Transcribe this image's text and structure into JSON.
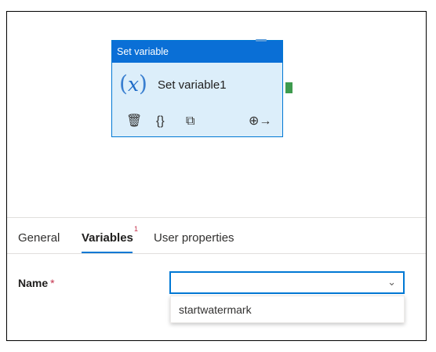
{
  "activity": {
    "type_label": "Set variable",
    "name": "Set variable1",
    "icon": "variable-fx-icon",
    "icon_text": "(",
    "icon_x": "x",
    "icon_close": ")",
    "actions": [
      {
        "name": "delete-icon",
        "glyph": "🗑"
      },
      {
        "name": "code-icon",
        "glyph": "{}"
      },
      {
        "name": "copy-icon",
        "glyph": "⧉"
      },
      {
        "name": "add-output-icon",
        "glyph": "⊕→"
      }
    ],
    "colors": {
      "header": "#0a6fd6",
      "body": "#dceefa",
      "connector": "#3e9b4e"
    }
  },
  "tabs": [
    {
      "label": "General"
    },
    {
      "label": "Variables",
      "badge": "1",
      "active": true
    },
    {
      "label": "User properties"
    }
  ],
  "form": {
    "name_label": "Name",
    "required_marker": "*",
    "name_value": "",
    "options": [
      "startwatermark"
    ]
  }
}
